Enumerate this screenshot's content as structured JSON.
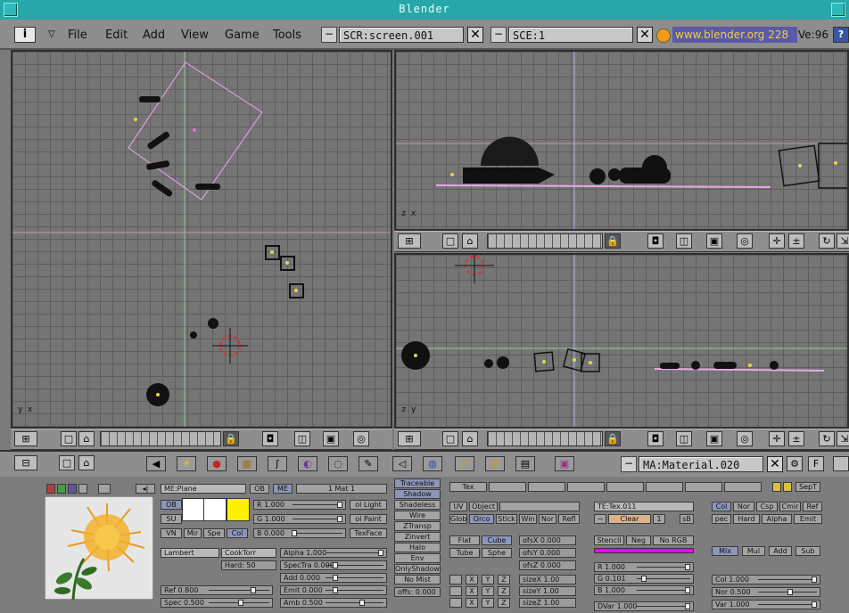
{
  "window": {
    "title": "Blender"
  },
  "topbar": {
    "menus": [
      "File",
      "Edit",
      "Add",
      "View",
      "Game",
      "Tools"
    ],
    "screen": "SCR:screen.001",
    "scene": "SCE:1",
    "link": "www.blender.org 228",
    "version": "Ve:96"
  },
  "colors": {
    "accent": "#27a7a7",
    "grid": "#757575",
    "selection": "#e8a8e8",
    "link_bar": "#5a5aa8",
    "header": "#8e8e8e"
  },
  "viewports": {
    "top": {
      "axis": "y x"
    },
    "front": {
      "axis": "z x"
    },
    "side": {
      "axis": "z y"
    }
  },
  "buttons_header": {
    "material": "MA:Material.020",
    "f_label": "F"
  },
  "material": {
    "me_label": "ME:Plane",
    "ob": "OB",
    "me": "ME",
    "user_count": "1 Mat 1",
    "rgb_modes": [
      "OB",
      "SU",
      "VN",
      "Mir",
      "Spe",
      "Col"
    ],
    "r": "R 1.000",
    "g": "G 1.000",
    "b": "B 0.000",
    "light_btns": [
      "ol Light",
      "ol Paint",
      "TexFace"
    ],
    "diffuse": "Lambert",
    "spec_shader": "CookTorr",
    "hard": "Hard: 50",
    "alpha": "Alpha 1.000",
    "spectra": "SpecTra 0.000",
    "add": "Add 0.000",
    "emit": "Emit 0.000",
    "amb": "Amb  0.500",
    "ref": "Ref  0.800",
    "spec": "Spec 0.500",
    "modes": [
      "Traceable",
      "Shadow",
      "Shadeless",
      "Wire",
      "ZTransp",
      "Zinvert",
      "Halo",
      "Env",
      "OnlyShadow",
      "No Mist"
    ],
    "offs": "offs: 0.000"
  },
  "texture": {
    "tab": "Tex",
    "coords": [
      "UV",
      "Object"
    ],
    "mapping": [
      "Glob",
      "Orco",
      "Stick",
      "Win",
      "Nor",
      "Refl"
    ],
    "proj": [
      "Flat",
      "Cube",
      "Tube",
      "Sphe"
    ],
    "ofs": [
      "ofsX 0.000",
      "ofsY 0.000",
      "ofsZ 0.000"
    ],
    "size": [
      "sizeX 1.00",
      "sizeY 1.00",
      "sizeZ 1.00"
    ],
    "xyz": [
      "X",
      "Y",
      "Z"
    ],
    "tex_name": "TE:Tex.011",
    "clear": "Clear",
    "users": "1",
    "sb": "sB",
    "flags": [
      "Stencil",
      "Neg",
      "No RGB"
    ],
    "r": "R 1.000",
    "g": "G 0.101",
    "b": "B 1.000",
    "dvar": "DVar 1.000",
    "sep_label": "SepT"
  },
  "mapto": {
    "row1": [
      "Col",
      "Nor",
      "Csp",
      "Cmir",
      "Ref"
    ],
    "row2": [
      "pec",
      "Hard",
      "Alpha",
      "Emit"
    ],
    "blend": [
      "Mix",
      "Mul",
      "Add",
      "Sub"
    ],
    "col": "Col 1.000",
    "nor": "Nor 0.500",
    "var": "Var 1.000"
  }
}
